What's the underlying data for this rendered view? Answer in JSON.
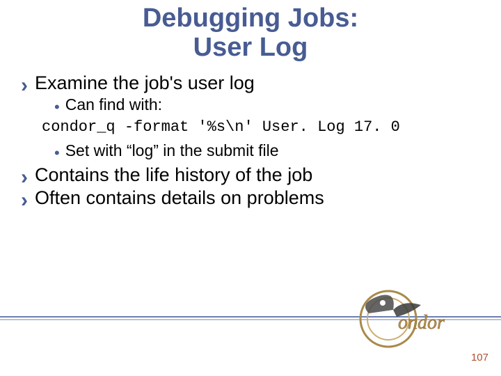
{
  "title_line1": "Debugging Jobs:",
  "title_line2": "User Log",
  "bullets": {
    "b1": "Examine the job's user log",
    "b2": "Contains the life history of the job",
    "b3": "Often contains details on problems"
  },
  "sub": {
    "s1": "Can find with:",
    "s2": "Set with “log” in the submit file"
  },
  "code": "condor_q -format '%s\\n' User. Log 17. 0",
  "page_number": "107",
  "logo_text": "ondor"
}
